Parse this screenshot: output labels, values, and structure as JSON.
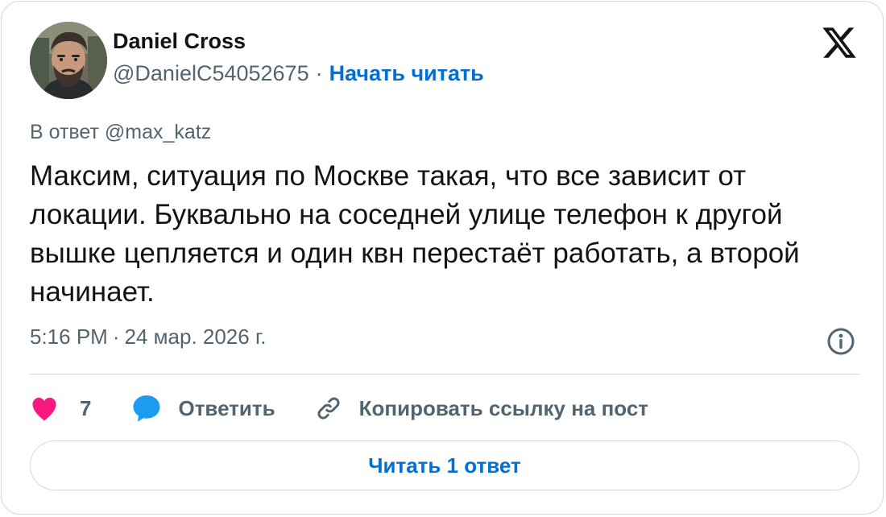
{
  "author": {
    "name": "Daniel Cross",
    "handle": "@DanielC54052675",
    "separator": "·",
    "follow_label": "Начать читать"
  },
  "tweet": {
    "reply_prefix": "В ответ",
    "reply_to": "@max_katz",
    "text": "Максим, ситуация по Москве такая, что все зависит от локации. Буквально на соседней улице телефон к другой вышке цепляется и один квн перестаёт работать, а второй начинает.",
    "time": "5:16 PM",
    "date_separator": "·",
    "date": "24 мар. 2026 г."
  },
  "actions": {
    "like_count": "7",
    "reply_label": "Ответить",
    "copy_link_label": "Копировать ссылку на пост"
  },
  "read_replies_label": "Читать 1 ответ",
  "icons": {
    "brand": "x-logo-icon",
    "info": "info-icon",
    "like": "heart-icon",
    "reply": "speech-bubble-icon",
    "copy": "link-icon"
  },
  "colors": {
    "link": "#006fd6",
    "text": "#0f1419",
    "secondary": "#536471",
    "heart": "#f91880",
    "bubble": "#1d9bf0",
    "border": "#cfd9de"
  }
}
